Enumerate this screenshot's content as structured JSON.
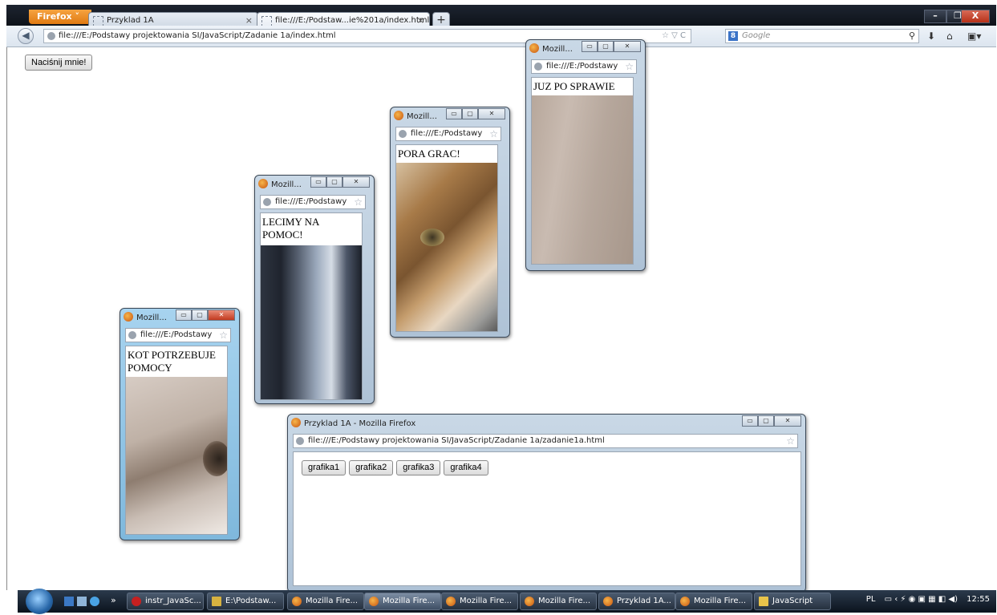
{
  "browser": {
    "menu_label": "Firefox ˅",
    "tabs": [
      {
        "label": "Przyklad 1A"
      },
      {
        "label": "file:///E:/Podstaw...ie%201a/index.html"
      }
    ],
    "url": "file:///E:/Podstawy projektowania SI/JavaScript/Zadanie 1a/index.html",
    "search_engine_icon": "8",
    "search_placeholder": "Google"
  },
  "page": {
    "button_label": "Naciśnij mnie!"
  },
  "popups": [
    {
      "title": "Mozill...",
      "url": "file:///E:/Podstawy",
      "text": "KOT POTRZEBUJE POMOCY"
    },
    {
      "title": "Mozill...",
      "url": "file:///E:/Podstawy",
      "text": "LECIMY NA POMOC!"
    },
    {
      "title": "Mozill...",
      "url": "file:///E:/Podstawy",
      "text": "PORA GRAC!"
    },
    {
      "title": "Mozill...",
      "url": "file:///E:/Podstawy",
      "text": "JUZ PO SPRAWIE"
    }
  ],
  "main_popup": {
    "title": "Przyklad 1A - Mozilla Firefox",
    "url": "file:///E:/Podstawy projektowania SI/JavaScript/Zadanie 1a/zadanie1a.html",
    "buttons": [
      "grafika1",
      "grafika2",
      "grafika3",
      "grafika4"
    ]
  },
  "taskbar": {
    "overflow": "»",
    "items": [
      "instr_JavaSc...",
      "E:\\Podstaw...",
      "Mozilla Fire...",
      "Mozilla Fire...",
      "Mozilla Fire...",
      "Mozilla Fire...",
      "Przyklad 1A...",
      "Mozilla Fire...",
      "JavaScript"
    ],
    "language": "PL",
    "clock": "12:55"
  }
}
